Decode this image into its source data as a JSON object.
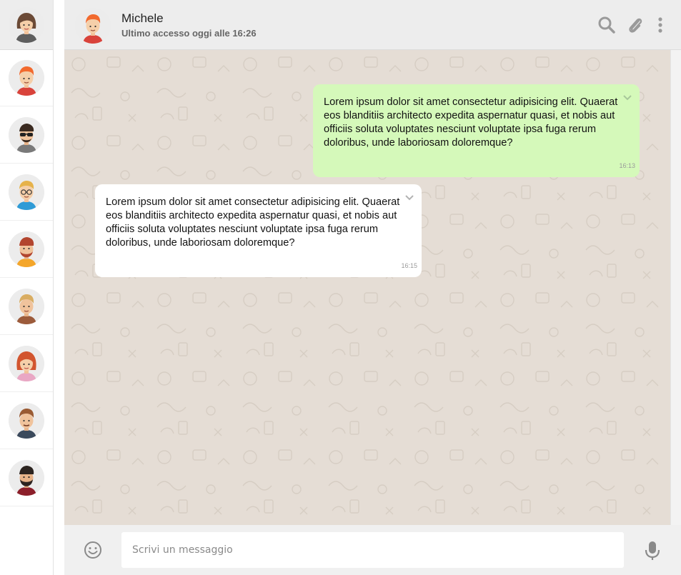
{
  "current_user": {
    "avatar": "female-user-avatar"
  },
  "contacts": [
    {
      "avatar": "avatar-redhead-man"
    },
    {
      "avatar": "avatar-sunglasses-man"
    },
    {
      "avatar": "avatar-blond-glasses-man"
    },
    {
      "avatar": "avatar-bearded-man-orange-shirt"
    },
    {
      "avatar": "avatar-blond-man"
    },
    {
      "avatar": "avatar-redhead-woman"
    },
    {
      "avatar": "avatar-brown-hair-man"
    },
    {
      "avatar": "avatar-dark-beard-man"
    }
  ],
  "chat": {
    "contact_name": "Michele",
    "last_seen": "Ultimo accesso oggi alle 16:26",
    "header_icons": [
      "search-icon",
      "paperclip-icon",
      "menu-dots-icon"
    ]
  },
  "messages": [
    {
      "direction": "sent",
      "text": "Lorem ipsum dolor sit amet consectetur adipisicing elit. Quaerat eos blanditiis architecto expedita aspernatur quasi, et nobis aut officiis soluta voluptates nesciunt voluptate ipsa fuga rerum doloribus, unde laboriosam doloremque?",
      "time": "16:13"
    },
    {
      "direction": "received",
      "text": "Lorem ipsum dolor sit amet consectetur adipisicing elit. Quaerat eos blanditiis architecto expedita aspernatur quasi, et nobis aut officiis soluta voluptates nesciunt voluptate ipsa fuga rerum doloribus, unde laboriosam doloremque?",
      "time": "16:15"
    }
  ],
  "composer": {
    "placeholder": "Scrivi un messaggio",
    "value": ""
  },
  "colors": {
    "sent_bubble": "#d5f9ba",
    "received_bubble": "#ffffff",
    "chat_background": "#e5ddd5",
    "header_background": "#ededed"
  }
}
